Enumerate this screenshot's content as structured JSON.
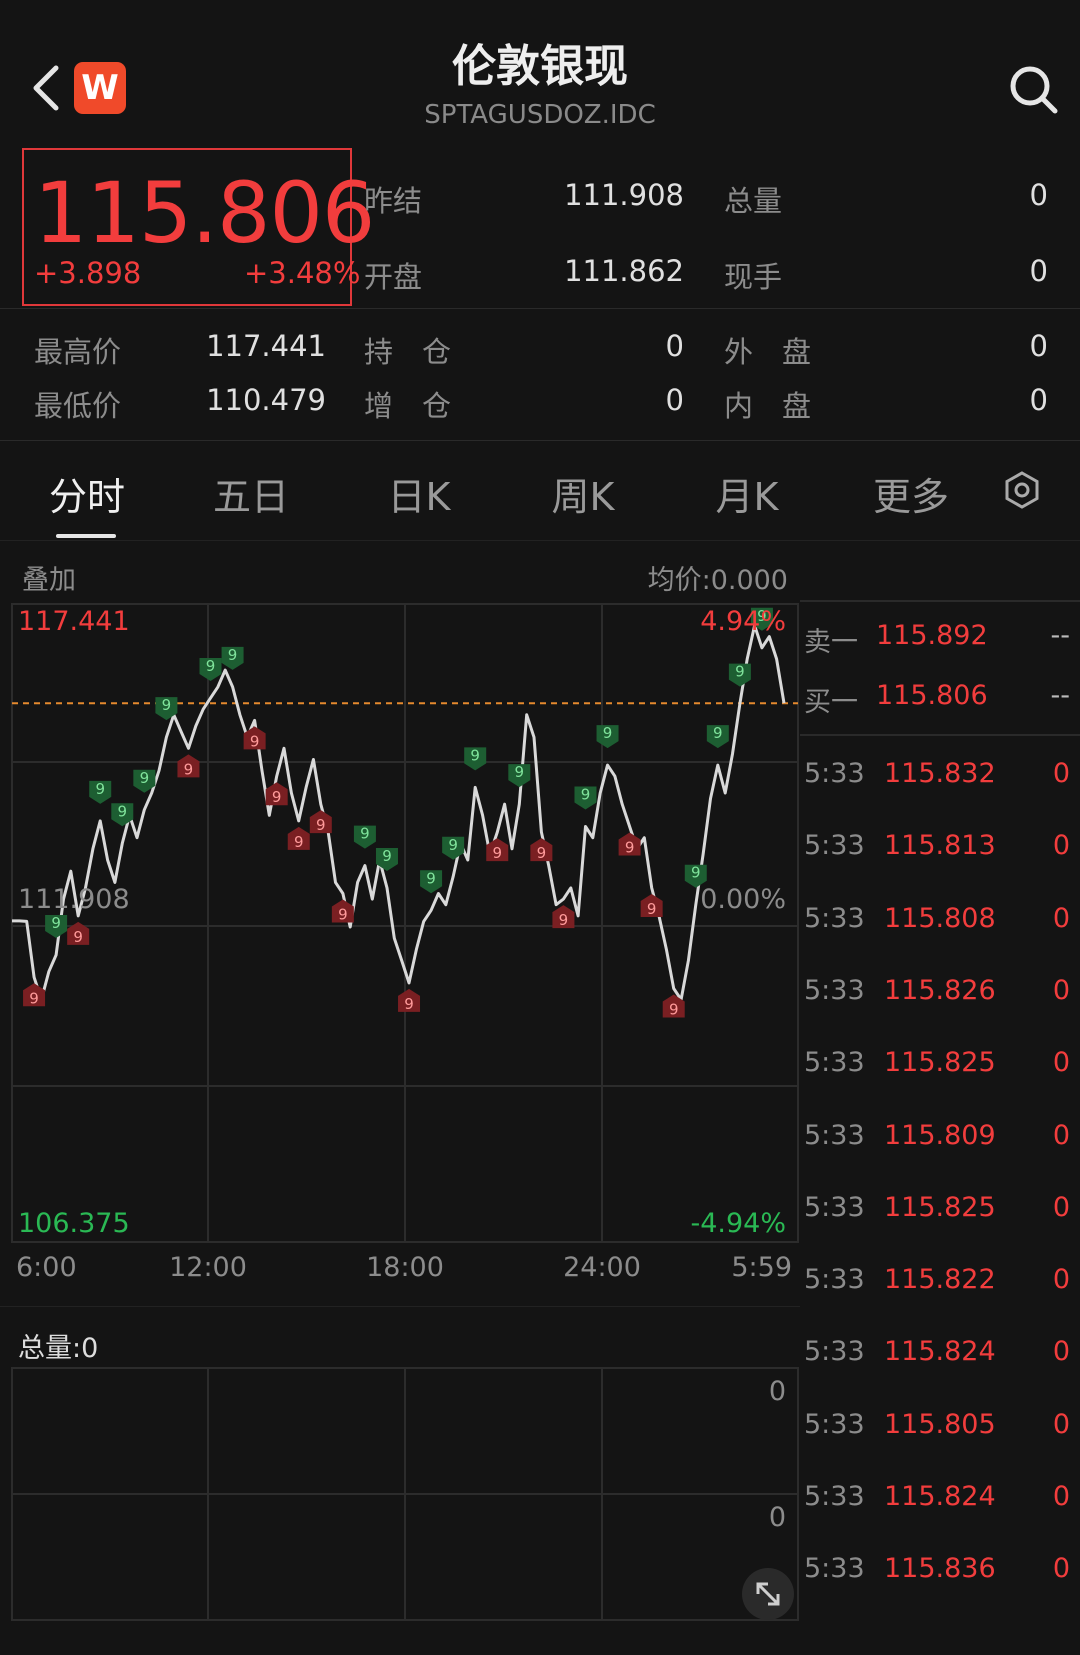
{
  "header": {
    "title": "伦敦银现",
    "code": "SPTAGUSDOZ.IDC",
    "logo_letter": "W"
  },
  "quote": {
    "price": "115.806",
    "change": "+3.898",
    "change_pct": "+3.48%",
    "rows": [
      [
        {
          "label": "昨结",
          "value": "111.908"
        },
        {
          "label": "总量",
          "value": "0"
        }
      ],
      [
        {
          "label": "开盘",
          "value": "111.862"
        },
        {
          "label": "现手",
          "value": "0"
        }
      ]
    ],
    "stats": [
      [
        {
          "label": "最高价",
          "value": "117.441"
        },
        {
          "label": "持　仓",
          "value": "0"
        },
        {
          "label": "外　盘",
          "value": "0"
        }
      ],
      [
        {
          "label": "最低价",
          "value": "110.479"
        },
        {
          "label": "增　仓",
          "value": "0"
        },
        {
          "label": "内　盘",
          "value": "0"
        }
      ]
    ]
  },
  "tabs": [
    "分时",
    "五日",
    "日K",
    "周K",
    "月K",
    "更多"
  ],
  "chart_header": {
    "overlay": "叠加",
    "avg_price": "均价:0.000"
  },
  "chart_data": {
    "type": "line",
    "y_high": "117.441",
    "y_low": "106.375",
    "y_mid": "111.908",
    "pct_high": "4.94%",
    "pct_mid": "0.00%",
    "pct_low": "-4.94%",
    "x_ticks": [
      "6:00",
      "12:00",
      "18:00",
      "24:00",
      "5:59"
    ],
    "ylim": [
      106.375,
      117.441
    ],
    "prev_settle": 111.908,
    "current": 115.806,
    "series": [
      {
        "values": [
          111.91,
          111.91,
          111.9,
          110.9,
          110.5,
          111.0,
          111.3,
          112.3,
          112.8,
          112.0,
          112.5,
          113.2,
          113.7,
          113.0,
          112.6,
          113.3,
          113.8,
          113.4,
          113.9,
          114.2,
          114.6,
          115.2,
          115.6,
          115.3,
          115.0,
          115.4,
          115.7,
          115.9,
          116.1,
          116.4,
          116.1,
          115.6,
          115.2,
          115.5,
          114.6,
          113.8,
          114.5,
          115.0,
          114.2,
          113.7,
          114.3,
          114.8,
          114.0,
          113.5,
          112.6,
          112.4,
          111.8,
          112.6,
          112.9,
          112.3,
          113.0,
          112.5,
          111.6,
          111.2,
          110.8,
          111.4,
          111.9,
          112.1,
          112.4,
          112.2,
          112.7,
          113.3,
          113.0,
          114.3,
          113.8,
          113.1,
          113.5,
          114.0,
          113.2,
          114.0,
          115.6,
          115.2,
          113.5,
          112.9,
          112.2,
          112.3,
          112.5,
          112.0,
          113.6,
          113.4,
          114.2,
          114.7,
          114.5,
          114.0,
          113.6,
          113.2,
          113.4,
          112.5,
          112.0,
          111.4,
          110.7,
          110.5,
          111.2,
          112.2,
          113.1,
          114.1,
          114.7,
          114.2,
          114.9,
          115.8,
          116.6,
          117.2,
          116.8,
          117.0,
          116.6,
          115.81
        ]
      }
    ]
  },
  "markers": {
    "green_label": "9",
    "red_label": "9"
  },
  "order_book": [
    {
      "label": "卖一",
      "price": "115.892",
      "vol": "--"
    },
    {
      "label": "买一",
      "price": "115.806",
      "vol": "--"
    }
  ],
  "trades": [
    {
      "time": "5:33",
      "price": "115.832",
      "vol": "0"
    },
    {
      "time": "5:33",
      "price": "115.813",
      "vol": "0"
    },
    {
      "time": "5:33",
      "price": "115.808",
      "vol": "0"
    },
    {
      "time": "5:33",
      "price": "115.826",
      "vol": "0"
    },
    {
      "time": "5:33",
      "price": "115.825",
      "vol": "0"
    },
    {
      "time": "5:33",
      "price": "115.809",
      "vol": "0"
    },
    {
      "time": "5:33",
      "price": "115.825",
      "vol": "0"
    },
    {
      "time": "5:33",
      "price": "115.822",
      "vol": "0"
    },
    {
      "time": "5:33",
      "price": "115.824",
      "vol": "0"
    },
    {
      "time": "5:33",
      "price": "115.805",
      "vol": "0"
    },
    {
      "time": "5:33",
      "price": "115.824",
      "vol": "0"
    },
    {
      "time": "5:33",
      "price": "115.836",
      "vol": "0"
    }
  ],
  "volume": {
    "label": "总量:0",
    "top_value": "0",
    "mid_value": "0"
  },
  "colors": {
    "up": "#f23d3d",
    "down": "#2ab954",
    "grid": "#2c2c2c",
    "line": "#d9d9d9"
  }
}
